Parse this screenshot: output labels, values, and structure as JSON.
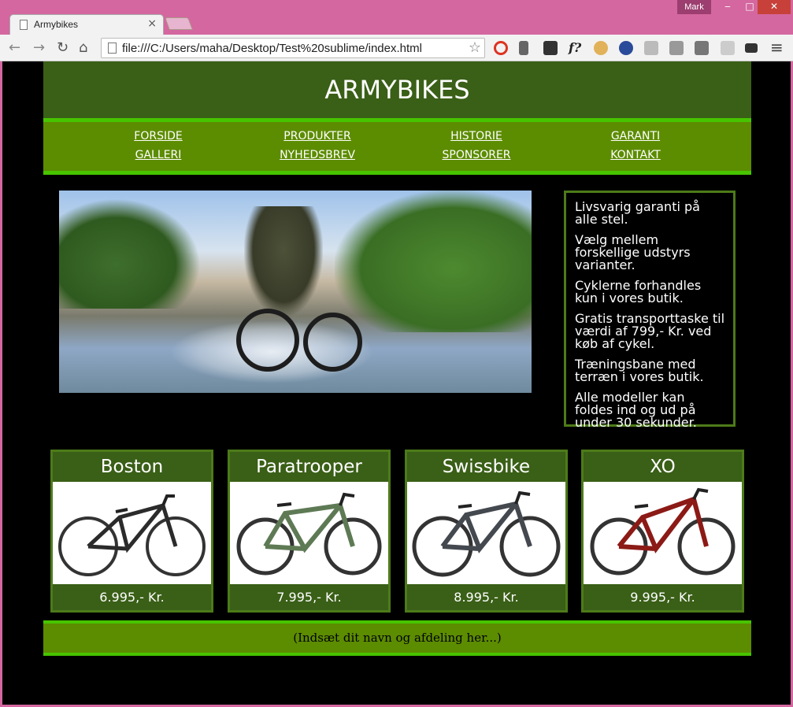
{
  "window": {
    "user": "Mark",
    "min": "‒",
    "max": "□",
    "close": "✕"
  },
  "tab": {
    "title": "Armybikes",
    "close": "×"
  },
  "toolbar": {
    "back": "←",
    "forward": "→",
    "reload": "↻",
    "home": "⌂",
    "url": "file:///C:/Users/maha/Desktop/Test%20sublime/index.html",
    "star": "☆",
    "font_ext": "f?",
    "menu": "≡"
  },
  "site": {
    "title": "ARMYBIKES",
    "nav": [
      {
        "label": "FORSIDE"
      },
      {
        "label": "PRODUKTER"
      },
      {
        "label": "HISTORIE"
      },
      {
        "label": "GARANTI"
      },
      {
        "label": "GALLERI"
      },
      {
        "label": "NYHEDSBREV"
      },
      {
        "label": "SPONSORER"
      },
      {
        "label": "KONTAKT"
      }
    ],
    "info": [
      "Livsvarig garanti på alle stel.",
      "Vælg mellem forskellige udstyrs varianter.",
      "Cyklerne forhandles kun i vores butik.",
      "Gratis transporttaske til værdi af 799,- Kr. ved køb af cykel.",
      "Træningsbane med terræn i vores butik.",
      "Alle modeller kan foldes ind og ud på under 30 sekunder."
    ],
    "products": [
      {
        "name": "Boston",
        "price": "6.995,- Kr.",
        "frame_color": "#2b2b2b"
      },
      {
        "name": "Paratrooper",
        "price": "7.995,- Kr.",
        "frame_color": "#5e7a55"
      },
      {
        "name": "Swissbike",
        "price": "8.995,- Kr.",
        "frame_color": "#44484f"
      },
      {
        "name": "XO",
        "price": "9.995,- Kr.",
        "frame_color": "#8c1a16"
      }
    ],
    "footer": "(Indsæt dit navn og afdeling her...)"
  }
}
